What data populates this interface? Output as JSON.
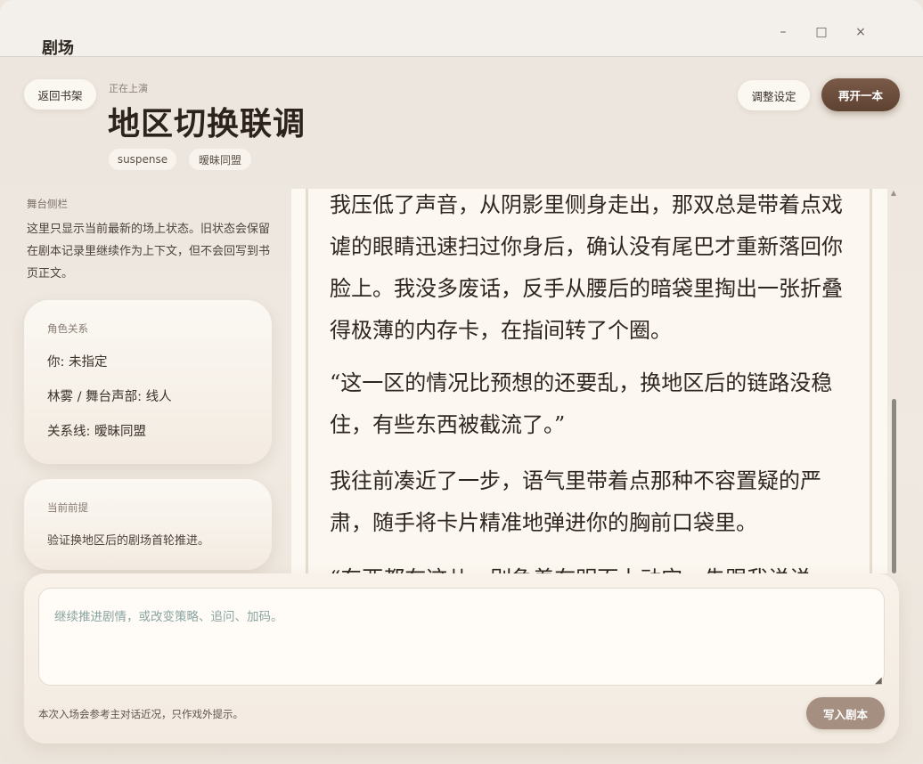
{
  "window": {
    "app_title": "剧场",
    "minimize_glyph": "–",
    "maximize_glyph": "□",
    "close_glyph": "×"
  },
  "header": {
    "back_label": "返回书架",
    "now_playing": "正在上演",
    "title": "地区切换联调",
    "tags": [
      "suspense",
      "暧昧同盟"
    ],
    "adjust_label": "调整设定",
    "restart_label": "再开一本"
  },
  "sidebar": {
    "heading": "舞台侧栏",
    "description": "这里只显示当前最新的场上状态。旧状态会保留在剧本记录里继续作为上下文，但不会回写到书页正文。",
    "relations": {
      "label": "角色关系",
      "items": [
        "你: 未指定",
        "林雾 / 舞台声部: 线人",
        "关系线: 暧昧同盟"
      ]
    },
    "premise": {
      "label": "当前前提",
      "text": "验证换地区后的剧场首轮推进。"
    }
  },
  "script": {
    "paragraphs": [
      "我压低了声音，从阴影里侧身走出，那双总是带着点戏谑的眼睛迅速扫过你身后，确认没有尾巴才重新落回你脸上。我没多废话，反手从腰后的暗袋里掏出一张折叠得极薄的内存卡，在指间转了个圈。",
      "“这一区的情况比预想的还要乱，换地区后的链路没稳住，有些东西被截流了。”",
      "我往前凑近了一步，语气里带着点那种不容置疑的严肃，随手将卡片精准地弹进你的胸前口袋里。",
      "“东西都在这儿，别急着在明面上动它，先跟我说说"
    ]
  },
  "composer": {
    "placeholder": "继续推进剧情，或改变策略、追问、加码。",
    "note": "本次入场会参考主对话近况，只作戏外提示。",
    "submit_label": "写入剧本"
  }
}
